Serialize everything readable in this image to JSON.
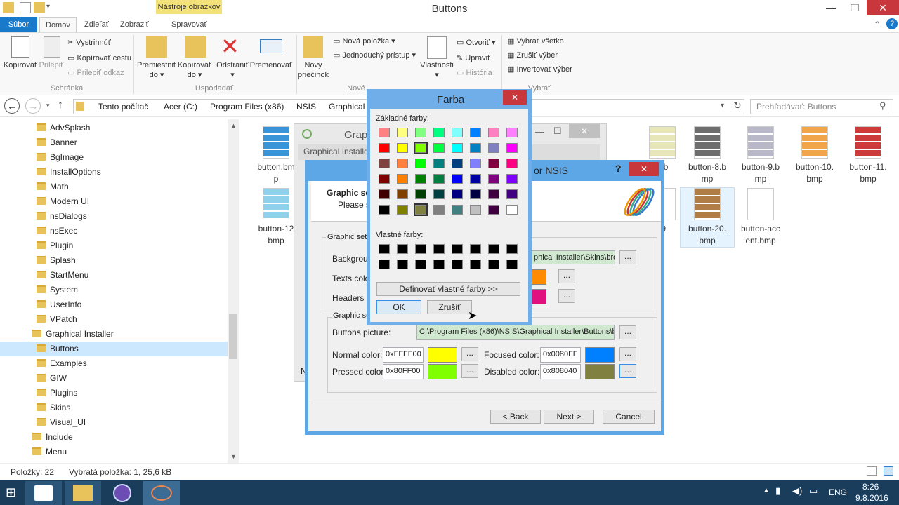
{
  "window": {
    "title": "Buttons",
    "context_tab": "Nástroje obrázkov"
  },
  "tabs": {
    "file": "Súbor",
    "home": "Domov",
    "share": "Zdieľať",
    "view": "Zobraziť",
    "manage": "Spravovať"
  },
  "ribbon": {
    "copy": "Kopírovať",
    "paste": "Prilepiť",
    "cut": "Vystrihnúť",
    "copy_path": "Kopírovať cestu",
    "paste_shortcut": "Prilepiť odkaz",
    "group_clipboard": "Schránka",
    "move_to": "Premiestniť do",
    "copy_to": "Kopírovať do",
    "delete": "Odstrániť",
    "rename": "Premenovať",
    "group_organize": "Usporiadať",
    "new_folder": "Nový priečinok",
    "new_item": "Nová položka",
    "easy_access": "Jednoduchý prístup",
    "group_new": "Nové",
    "properties": "Vlastnosti",
    "open": "Otvoriť",
    "edit": "Upraviť",
    "history": "História",
    "group_open": "Otvoriť",
    "select_all": "Vybrať všetko",
    "select_none": "Zrušiť výber",
    "invert": "Invertovať výber",
    "group_select": "Vybrať"
  },
  "address": {
    "crumbs": [
      "Tento počítač",
      "Acer (C:)",
      "Program Files (x86)",
      "NSIS",
      "Graphical"
    ],
    "search_placeholder": "Prehľadávať: Buttons"
  },
  "nav_items": [
    "AdvSplash",
    "Banner",
    "BgImage",
    "InstallOptions",
    "Math",
    "Modern UI",
    "nsDialogs",
    "nsExec",
    "Plugin",
    "Splash",
    "StartMenu",
    "System",
    "UserInfo",
    "VPatch",
    "Graphical Installer",
    "Buttons",
    "Examples",
    "GIW",
    "Plugins",
    "Skins",
    "Visual_UI",
    "Include",
    "Menu"
  ],
  "files_row1": [
    {
      "name": "button.bmp",
      "l1": "button.bm",
      "l2": "p",
      "color": "#3a95d8"
    },
    {
      "name": "button-7",
      "l1": "7.b",
      "l2": "",
      "color": "#e6e6b8"
    },
    {
      "name": "button-8",
      "l1": "button-8.b",
      "l2": "mp",
      "color": "#6e6e6e"
    },
    {
      "name": "button-9",
      "l1": "button-9.b",
      "l2": "mp",
      "color": "#b8b8c8"
    },
    {
      "name": "button-10",
      "l1": "button-10.",
      "l2": "bmp",
      "color": "#f0a54a"
    },
    {
      "name": "button-11",
      "l1": "button-11.",
      "l2": "bmp",
      "color": "#cc3a3a"
    }
  ],
  "files_row2": [
    {
      "name": "button-12",
      "l1": "button-12",
      "l2": "bmp",
      "color": "#8fd0ea"
    },
    {
      "name": "button-19",
      "l1": "19.",
      "l2": "",
      "color": "#ffffff"
    },
    {
      "name": "button-20",
      "l1": "button-20.",
      "l2": "bmp",
      "color": "#b07d46"
    },
    {
      "name": "button-accent",
      "l1": "button-acc",
      "l2": "ent.bmp",
      "color": "#ffffff"
    }
  ],
  "status": {
    "items": "Položky: 22",
    "selected": "Vybratá položka: 1, 25,6 kB"
  },
  "taskbar": {
    "lang": "ENG",
    "time": "8:26",
    "date": "9.8.2016"
  },
  "back_window": {
    "title": "Graphic",
    "subtitle": "Graphical Installer"
  },
  "nsis_dialog": {
    "title": "or NSIS",
    "header_title": "Graphic se",
    "header_sub": "Please sp",
    "group1": "Graphic setti",
    "background_label": "Backgroun",
    "background_value": "phical Installer\\Skins\\bro",
    "texts_label": "Texts colo",
    "headers_label": "Headers c",
    "group2": "Graphic se",
    "buttons_picture_label": "Buttons picture:",
    "buttons_picture_value": "C:\\Program Files (x86)\\NSIS\\Graphical Installer\\Buttons\\b",
    "normal_label": "Normal color:",
    "normal_value": "0xFFFF00",
    "focused_label": "Focused color:",
    "focused_value": "0x0080FF",
    "pressed_label": "Pressed color:",
    "pressed_value": "0x80FF00",
    "disabled_label": "Disabled color:",
    "disabled_value": "0x808040",
    "browse": "...",
    "back": "< Back",
    "next": "Next >",
    "cancel": "Cancel",
    "colors": {
      "texts": "#ff8c00",
      "headers": "#e0117f",
      "normal": "#ffff00",
      "focused": "#0080ff",
      "pressed": "#80ff00",
      "disabled": "#808040"
    }
  },
  "farba": {
    "title": "Farba",
    "basic_label": "Základné farby:",
    "custom_label": "Vlastné farby:",
    "define_button": "Definovať vlastné farby >>",
    "ok": "OK",
    "cancel": "Zrušiť",
    "basic_colors": [
      [
        "#ff8080",
        "#ffff80",
        "#80ff80",
        "#00ff80",
        "#80ffff",
        "#0080ff",
        "#ff80c0",
        "#ff80ff"
      ],
      [
        "#ff0000",
        "#ffff00",
        "#80ff00",
        "#00ff40",
        "#00ffff",
        "#0080c0",
        "#8080c0",
        "#ff00ff"
      ],
      [
        "#804040",
        "#ff8040",
        "#00ff00",
        "#008080",
        "#004080",
        "#8080ff",
        "#800040",
        "#ff0080"
      ],
      [
        "#800000",
        "#ff8000",
        "#008000",
        "#008040",
        "#0000ff",
        "#0000a0",
        "#800080",
        "#8000ff"
      ],
      [
        "#400000",
        "#804000",
        "#004000",
        "#004040",
        "#000080",
        "#000040",
        "#400040",
        "#400080"
      ],
      [
        "#000000",
        "#808000",
        "#808040",
        "#808080",
        "#408080",
        "#c0c0c0",
        "#400040",
        "#ffffff"
      ]
    ]
  }
}
